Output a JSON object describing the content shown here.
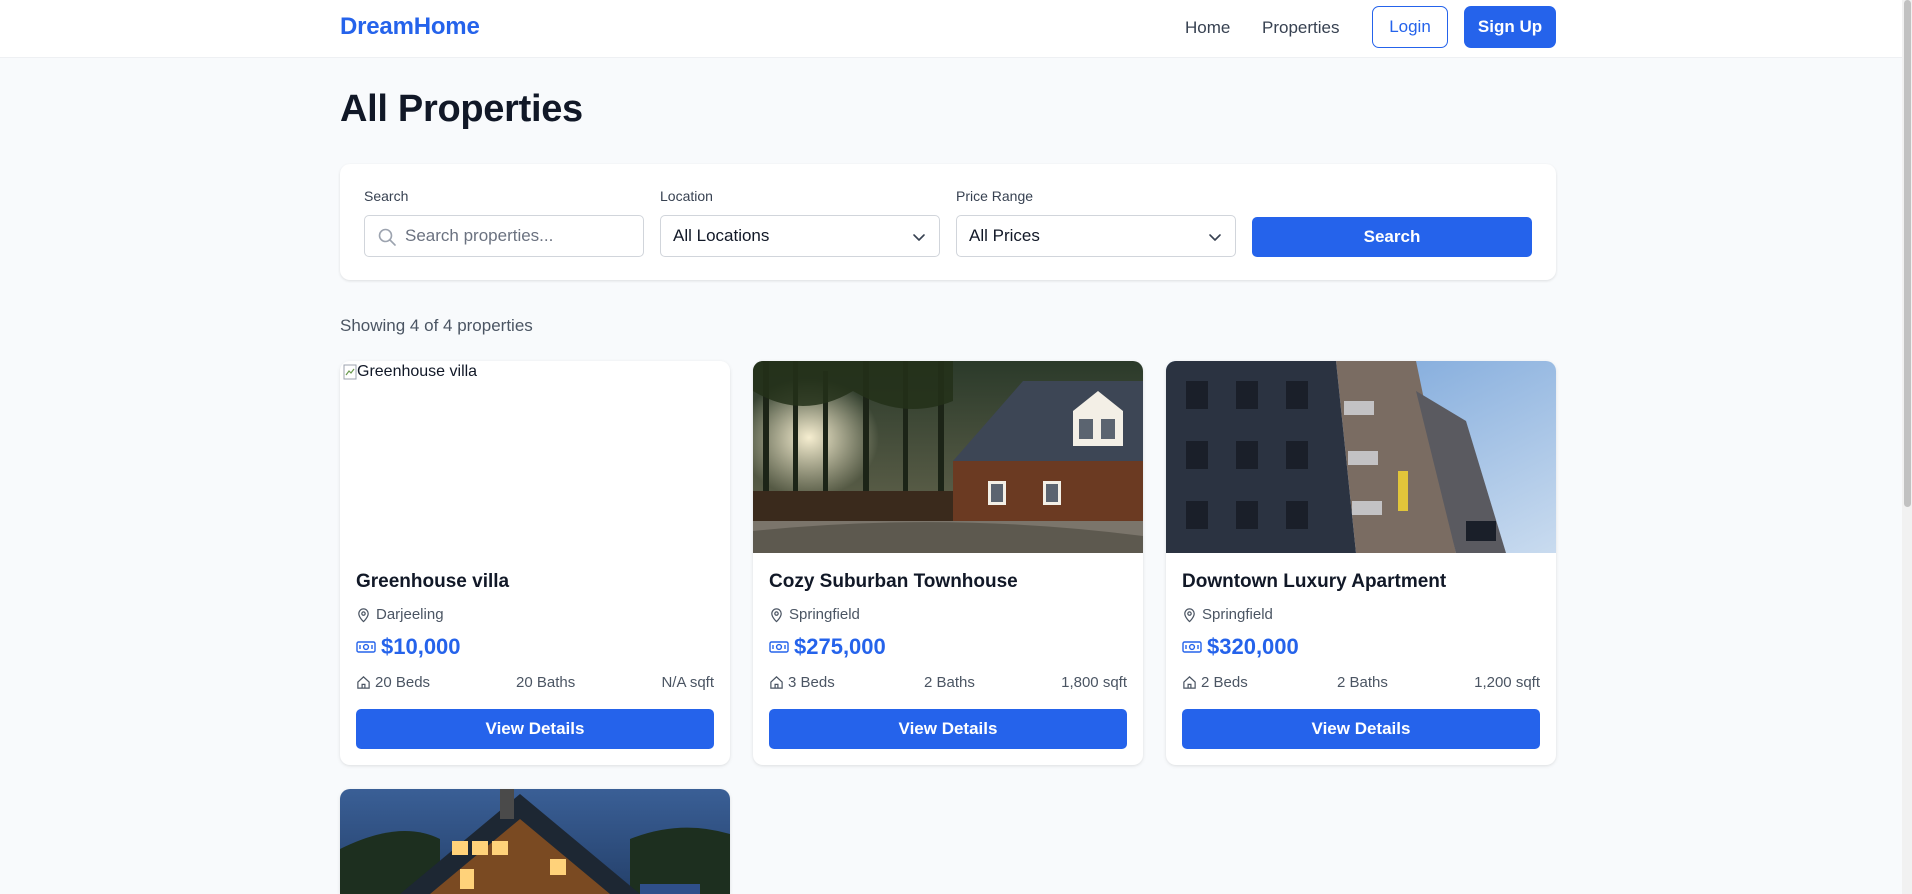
{
  "navbar": {
    "brand": "DreamHome",
    "links": [
      "Home",
      "Properties"
    ],
    "login_label": "Login",
    "signup_label": "Sign Up"
  },
  "page": {
    "title": "All Properties",
    "result_count": "Showing 4 of 4 properties"
  },
  "filters": {
    "search_label": "Search",
    "search_placeholder": "Search properties...",
    "location_label": "Location",
    "location_value": "All Locations",
    "price_label": "Price Range",
    "price_value": "All Prices",
    "search_button": "Search"
  },
  "properties": [
    {
      "image_alt": "Greenhouse villa",
      "image_broken": true,
      "title": "Greenhouse villa",
      "location": "Darjeeling",
      "price": "$10,000",
      "beds": "20 Beds",
      "baths": "20 Baths",
      "sqft": "N/A sqft",
      "button": "View Details"
    },
    {
      "image_alt": "Cozy Suburban Townhouse",
      "title": "Cozy Suburban Townhouse",
      "location": "Springfield",
      "price": "$275,000",
      "beds": "3 Beds",
      "baths": "2 Baths",
      "sqft": "1,800 sqft",
      "button": "View Details"
    },
    {
      "image_alt": "Downtown Luxury Apartment",
      "title": "Downtown Luxury Apartment",
      "location": "Springfield",
      "price": "$320,000",
      "beds": "2 Beds",
      "baths": "2 Baths",
      "sqft": "1,200 sqft",
      "button": "View Details"
    },
    {
      "image_alt": "Mountain cabin"
    }
  ],
  "colors": {
    "accent": "#2563eb",
    "background": "#f8fafc",
    "text": "#111827",
    "muted": "#4b5563"
  }
}
